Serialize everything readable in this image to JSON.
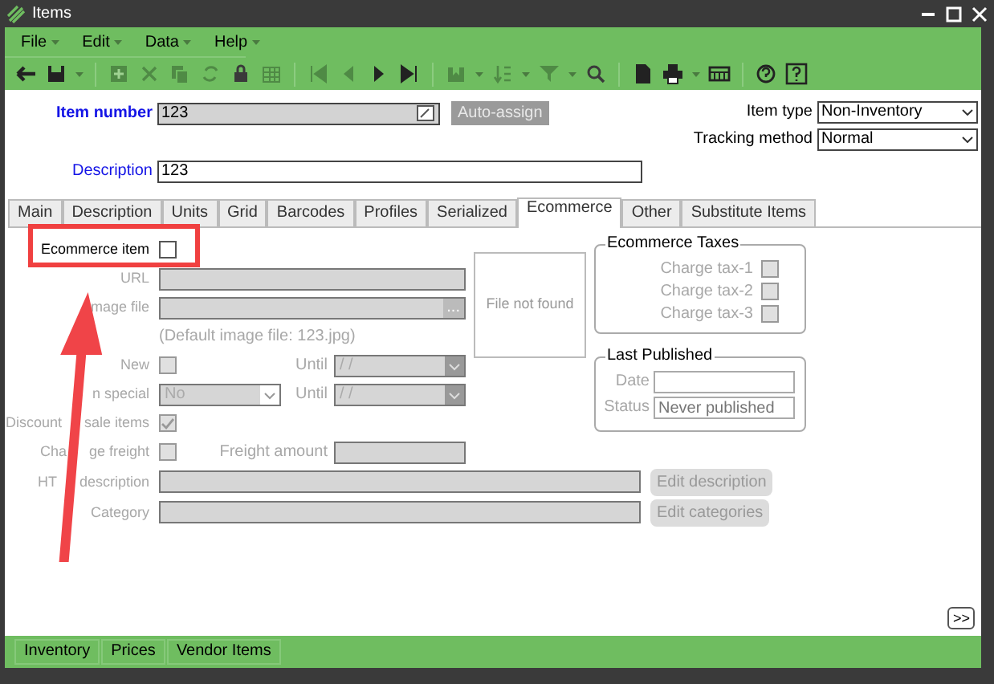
{
  "window": {
    "title": "Items"
  },
  "menu": [
    {
      "label": "File"
    },
    {
      "label": "Edit"
    },
    {
      "label": "Data"
    },
    {
      "label": "Help"
    }
  ],
  "header": {
    "item_number": {
      "label": "Item number",
      "value": "123"
    },
    "auto_assign": "Auto-assign",
    "description": {
      "label": "Description",
      "value": "123"
    },
    "item_type": {
      "label": "Item type",
      "value": "Non-Inventory"
    },
    "tracking_method": {
      "label": "Tracking method",
      "value": "Normal"
    }
  },
  "tabs": [
    {
      "label": "Main",
      "selected": false
    },
    {
      "label": "Description",
      "selected": false
    },
    {
      "label": "Units",
      "selected": false
    },
    {
      "label": "Grid",
      "selected": false
    },
    {
      "label": "Barcodes",
      "selected": false
    },
    {
      "label": "Profiles",
      "selected": false
    },
    {
      "label": "Serialized",
      "selected": false
    },
    {
      "label": "Ecommerce",
      "selected": true
    },
    {
      "label": "Other",
      "selected": false
    },
    {
      "label": "Substitute Items",
      "selected": false
    }
  ],
  "rows": [
    {
      "label": [
        "Ecommerce item"
      ],
      "disabled": false,
      "controls": [
        {
          "kind": "checkbox",
          "checked": false
        }
      ]
    },
    {
      "label": [
        "URL"
      ],
      "disabled": true,
      "controls": [
        {
          "kind": "text"
        }
      ]
    },
    {
      "label": [
        "mage file"
      ],
      "disabled": true,
      "controls": [
        {
          "kind": "file",
          "button": "..."
        }
      ]
    },
    {
      "label": [],
      "controls": [
        {
          "kind": "hint",
          "text": "(Default image file: 123.jpg)"
        }
      ]
    },
    {
      "label": [
        "New"
      ],
      "disabled": true,
      "controls": [
        {
          "kind": "checkbox",
          "checked": false
        },
        {
          "kind": "label",
          "text": "Until"
        },
        {
          "kind": "date",
          "value": "/ /"
        }
      ]
    },
    {
      "label": [
        "n special"
      ],
      "disabled": true,
      "controls": [
        {
          "kind": "select",
          "value": "No"
        },
        {
          "kind": "label",
          "text": "Until"
        },
        {
          "kind": "date",
          "value": "/ /"
        }
      ]
    },
    {
      "label": [
        "Discount",
        "sale items"
      ],
      "disabled": true,
      "controls": [
        {
          "kind": "checkbox",
          "checked": true
        }
      ]
    },
    {
      "label": [
        "Cha",
        "ge freight"
      ],
      "disabled": true,
      "controls": [
        {
          "kind": "checkbox",
          "checked": false
        },
        {
          "kind": "label",
          "text": "Freight amount"
        },
        {
          "kind": "text"
        }
      ]
    }
  ],
  "preview": {
    "text": "File not found"
  },
  "taxes": {
    "title": "Ecommerce Taxes",
    "items": [
      {
        "label": "Charge tax-1",
        "checked": false,
        "disabled": true
      },
      {
        "label": "Charge tax-2",
        "checked": false,
        "disabled": true
      },
      {
        "label": "Charge tax-3",
        "checked": false,
        "disabled": true
      }
    ]
  },
  "last_published": {
    "title": "Last Published",
    "fields": [
      {
        "label": "Date"
      },
      {
        "label": "Status",
        "placeholder": "Never published"
      }
    ],
    "disabled": true
  },
  "wide_rows": [
    {
      "label": [
        "HT",
        "description"
      ],
      "disabled": true,
      "button": "Edit description"
    },
    {
      "label": [
        "Category"
      ],
      "disabled": true,
      "button": "Edit categories"
    }
  ],
  "more_button": ">>",
  "bottom_tabs": [
    {
      "label": "Inventory"
    },
    {
      "label": "Prices"
    },
    {
      "label": "Vendor Items"
    }
  ]
}
